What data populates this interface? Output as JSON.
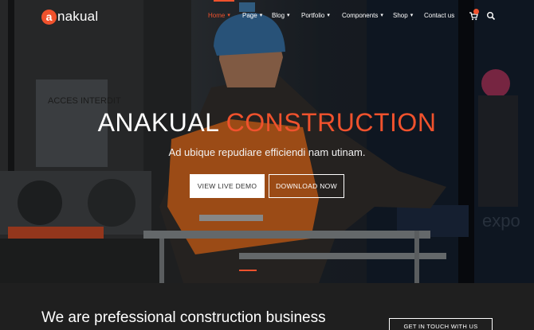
{
  "brand": {
    "logo_letter": "a",
    "logo_rest": "nakual"
  },
  "nav": {
    "items": [
      {
        "label": "Home",
        "chevron": "▾"
      },
      {
        "label": "Page",
        "chevron": "▾"
      },
      {
        "label": "Blog",
        "chevron": "▾"
      },
      {
        "label": "Portfolio",
        "chevron": "▾"
      },
      {
        "label": "Components",
        "chevron": "▾"
      },
      {
        "label": "Shop",
        "chevron": "▾"
      },
      {
        "label": "Contact us",
        "chevron": ""
      }
    ],
    "active": "Home"
  },
  "hero": {
    "title_main": "ANAKUAL",
    "title_accent": "CONSTRUCTION",
    "subtitle": "Ad ubique repudiare efficiendi nam utinam.",
    "primary_button": "VIEW LIVE DEMO",
    "secondary_button": "DOWNLOAD NOW",
    "scene_text_left": "ACCES INTERDIT",
    "scene_text_right": "expo"
  },
  "promo": {
    "text": "We are prefessional construction business",
    "button": "GET IN TOUCH WITH US"
  },
  "icons": {
    "cart": "cart-icon",
    "search": "search-icon"
  },
  "colors": {
    "accent": "#f0522d",
    "footer_bg": "#1f1f1f"
  }
}
